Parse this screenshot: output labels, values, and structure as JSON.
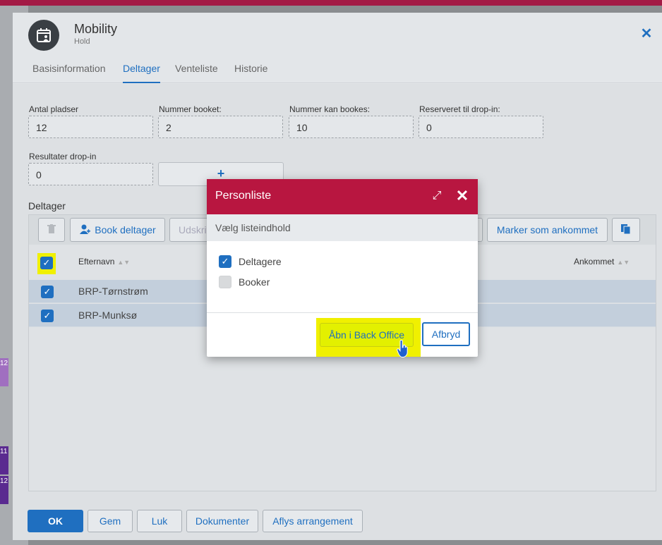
{
  "window": {
    "title": "Mobility",
    "subtitle": "Hold"
  },
  "tabs": [
    {
      "label": "Basisinformation",
      "active": false
    },
    {
      "label": "Deltager",
      "active": true
    },
    {
      "label": "Venteliste",
      "active": false
    },
    {
      "label": "Historie",
      "active": false
    }
  ],
  "fields": {
    "antal_pladser": {
      "label": "Antal pladser",
      "value": "12"
    },
    "nummer_booket": {
      "label": "Nummer booket:",
      "value": "2"
    },
    "nummer_kan_bookes": {
      "label": "Nummer kan bookes:",
      "value": "10"
    },
    "reserveret_dropin": {
      "label": "Reserveret til drop-in:",
      "value": "0"
    },
    "resultater_dropin": {
      "label": "Resultater drop-in",
      "value": "0"
    },
    "add_label": "+"
  },
  "participants": {
    "section_label": "Deltager",
    "toolbar": {
      "book": "Book deltager",
      "print": "Udskriv",
      "mark_arrived": "Marker som ankommet"
    },
    "columns": {
      "lastname": "Efternavn",
      "arrived": "Ankommet"
    },
    "rows": [
      {
        "lastname": "BRP-Tørnstrøm",
        "checked": true
      },
      {
        "lastname": "BRP-Munksø",
        "checked": true
      }
    ]
  },
  "footer": {
    "ok": "OK",
    "save": "Gem",
    "close": "Luk",
    "documents": "Dokumenter",
    "cancel_event": "Aflys arrangement"
  },
  "background": {
    "cell_labels": [
      "12",
      "11",
      "12"
    ]
  },
  "modal": {
    "title": "Personliste",
    "subtitle": "Vælg listeindhold",
    "options": [
      {
        "label": "Deltagere",
        "checked": true
      },
      {
        "label": "Booker",
        "checked": false
      }
    ],
    "open_button": "Åbn i Back Office",
    "cancel_button": "Afbryd"
  },
  "colors": {
    "brand": "#b81640",
    "accent": "#1f6fc0",
    "highlight": "#f0f000"
  }
}
